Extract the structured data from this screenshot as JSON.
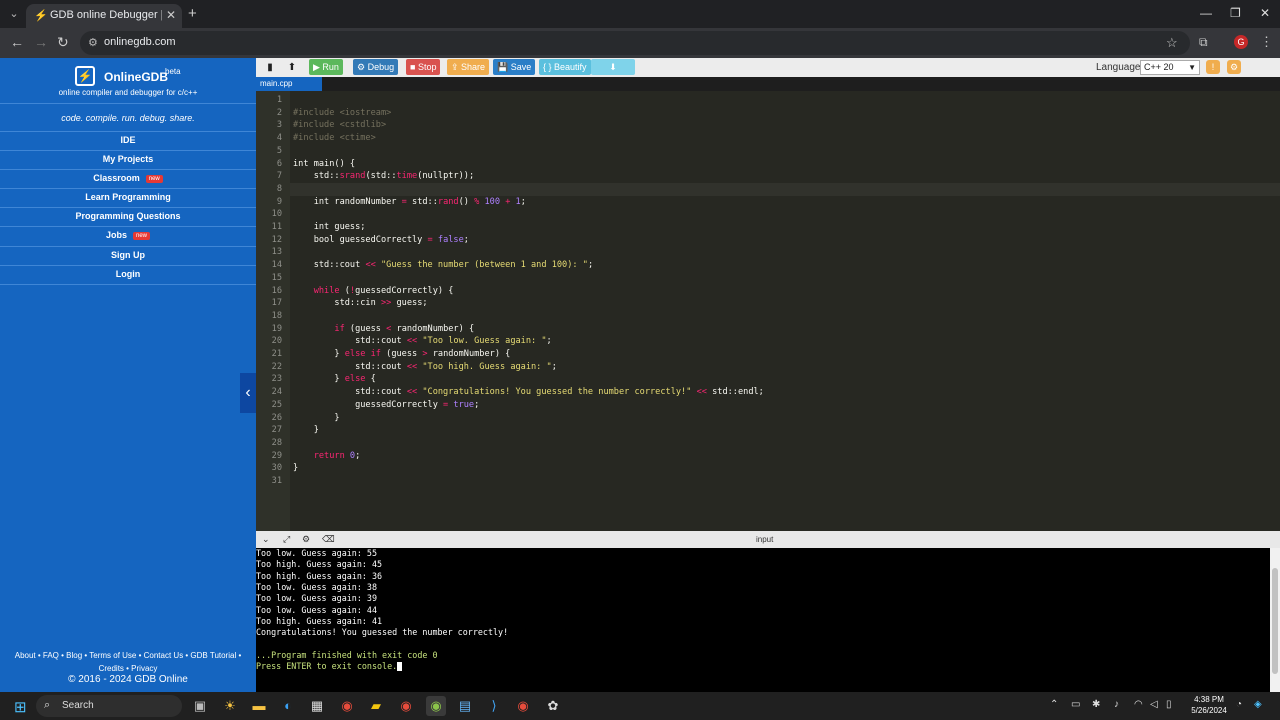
{
  "browser": {
    "tab_title": "GDB online Debugger | Compil",
    "url": "onlinegdb.com"
  },
  "sidebar": {
    "brand": "OnlineGDB",
    "beta": "beta",
    "tagline": "online compiler and debugger for c/c++",
    "motto": "code. compile. run. debug. share.",
    "nav": [
      {
        "label": "IDE",
        "badge": ""
      },
      {
        "label": "My Projects",
        "badge": ""
      },
      {
        "label": "Classroom",
        "badge": "new"
      },
      {
        "label": "Learn Programming",
        "badge": ""
      },
      {
        "label": "Programming Questions",
        "badge": ""
      },
      {
        "label": "Jobs",
        "badge": "new"
      },
      {
        "label": "Sign Up",
        "badge": ""
      },
      {
        "label": "Login",
        "badge": ""
      }
    ],
    "footer_line1": "About • FAQ • Blog • Terms of Use • Contact Us • GDB Tutorial •",
    "footer_line2": "Credits • Privacy",
    "copyright": "© 2016 - 2024 GDB Online"
  },
  "toolbar": {
    "run": "Run",
    "debug": "Debug",
    "stop": "Stop",
    "share": "Share",
    "save": "Save",
    "beautify": "{ } Beautify",
    "language_label": "Language",
    "language_value": "C++ 20"
  },
  "editor": {
    "file_tab": "main.cpp",
    "active_line": 8,
    "lines": [
      [],
      [
        {
          "t": "#include <iostream>",
          "c": "#75715e"
        }
      ],
      [
        {
          "t": "#include <cstdlib>",
          "c": "#75715e"
        }
      ],
      [
        {
          "t": "#include <ctime>",
          "c": "#75715e"
        }
      ],
      [],
      [
        {
          "t": "int main() {",
          "c": "#f8f8f2"
        }
      ],
      [
        {
          "t": "    std::",
          "c": "#f8f8f2"
        },
        {
          "t": "srand",
          "c": "#f92672"
        },
        {
          "t": "(std::",
          "c": "#f8f8f2"
        },
        {
          "t": "time",
          "c": "#f92672"
        },
        {
          "t": "(nullptr));",
          "c": "#f8f8f2"
        }
      ],
      [],
      [
        {
          "t": "    int randomNumber ",
          "c": "#f8f8f2"
        },
        {
          "t": "=",
          "c": "#f92672"
        },
        {
          "t": " std::",
          "c": "#f8f8f2"
        },
        {
          "t": "rand",
          "c": "#f92672"
        },
        {
          "t": "() ",
          "c": "#f8f8f2"
        },
        {
          "t": "%",
          "c": "#f92672"
        },
        {
          "t": " 100 ",
          "c": "#ae81ff"
        },
        {
          "t": "+",
          "c": "#f92672"
        },
        {
          "t": " 1",
          "c": "#ae81ff"
        },
        {
          "t": ";",
          "c": "#f8f8f2"
        }
      ],
      [],
      [
        {
          "t": "    int guess;",
          "c": "#f8f8f2"
        }
      ],
      [
        {
          "t": "    bool guessedCorrectly ",
          "c": "#f8f8f2"
        },
        {
          "t": "=",
          "c": "#f92672"
        },
        {
          "t": " false",
          "c": "#ae81ff"
        },
        {
          "t": ";",
          "c": "#f8f8f2"
        }
      ],
      [],
      [
        {
          "t": "    std::cout ",
          "c": "#f8f8f2"
        },
        {
          "t": "<<",
          "c": "#f92672"
        },
        {
          "t": " \"Guess the number (between 1 and 100): \"",
          "c": "#e6db74"
        },
        {
          "t": ";",
          "c": "#f8f8f2"
        }
      ],
      [],
      [
        {
          "t": "    while",
          "c": "#f92672"
        },
        {
          "t": " (",
          "c": "#f8f8f2"
        },
        {
          "t": "!",
          "c": "#f92672"
        },
        {
          "t": "guessedCorrectly) {",
          "c": "#f8f8f2"
        }
      ],
      [
        {
          "t": "        std::cin ",
          "c": "#f8f8f2"
        },
        {
          "t": ">>",
          "c": "#f92672"
        },
        {
          "t": " guess;",
          "c": "#f8f8f2"
        }
      ],
      [],
      [
        {
          "t": "        if",
          "c": "#f92672"
        },
        {
          "t": " (guess ",
          "c": "#f8f8f2"
        },
        {
          "t": "<",
          "c": "#f92672"
        },
        {
          "t": " randomNumber) {",
          "c": "#f8f8f2"
        }
      ],
      [
        {
          "t": "            std::cout ",
          "c": "#f8f8f2"
        },
        {
          "t": "<<",
          "c": "#f92672"
        },
        {
          "t": " \"Too low. Guess again: \"",
          "c": "#e6db74"
        },
        {
          "t": ";",
          "c": "#f8f8f2"
        }
      ],
      [
        {
          "t": "        } ",
          "c": "#f8f8f2"
        },
        {
          "t": "else if",
          "c": "#f92672"
        },
        {
          "t": " (guess ",
          "c": "#f8f8f2"
        },
        {
          "t": ">",
          "c": "#f92672"
        },
        {
          "t": " randomNumber) {",
          "c": "#f8f8f2"
        }
      ],
      [
        {
          "t": "            std::cout ",
          "c": "#f8f8f2"
        },
        {
          "t": "<<",
          "c": "#f92672"
        },
        {
          "t": " \"Too high. Guess again: \"",
          "c": "#e6db74"
        },
        {
          "t": ";",
          "c": "#f8f8f2"
        }
      ],
      [
        {
          "t": "        } ",
          "c": "#f8f8f2"
        },
        {
          "t": "else",
          "c": "#f92672"
        },
        {
          "t": " {",
          "c": "#f8f8f2"
        }
      ],
      [
        {
          "t": "            std::cout ",
          "c": "#f8f8f2"
        },
        {
          "t": "<<",
          "c": "#f92672"
        },
        {
          "t": " \"Congratulations! You guessed the number correctly!\" ",
          "c": "#e6db74"
        },
        {
          "t": "<<",
          "c": "#f92672"
        },
        {
          "t": " std::endl;",
          "c": "#f8f8f2"
        }
      ],
      [
        {
          "t": "            guessedCorrectly ",
          "c": "#f8f8f2"
        },
        {
          "t": "=",
          "c": "#f92672"
        },
        {
          "t": " true",
          "c": "#ae81ff"
        },
        {
          "t": ";",
          "c": "#f8f8f2"
        }
      ],
      [
        {
          "t": "        }",
          "c": "#f8f8f2"
        }
      ],
      [
        {
          "t": "    }",
          "c": "#f8f8f2"
        }
      ],
      [],
      [
        {
          "t": "    return",
          "c": "#f92672"
        },
        {
          "t": " 0",
          "c": "#ae81ff"
        },
        {
          "t": ";",
          "c": "#f8f8f2"
        }
      ],
      [
        {
          "t": "}",
          "c": "#f8f8f2"
        }
      ],
      []
    ]
  },
  "console": {
    "header_label": "input",
    "lines": [
      {
        "text": "Too low. Guess again: 55",
        "green": false
      },
      {
        "text": "Too high. Guess again: 45",
        "green": false
      },
      {
        "text": "Too high. Guess again: 36",
        "green": false
      },
      {
        "text": "Too low. Guess again: 38",
        "green": false
      },
      {
        "text": "Too low. Guess again: 39",
        "green": false
      },
      {
        "text": "Too low. Guess again: 44",
        "green": false
      },
      {
        "text": "Too high. Guess again: 41",
        "green": false
      },
      {
        "text": "Congratulations! You guessed the number correctly!",
        "green": false
      },
      {
        "text": "",
        "green": false
      },
      {
        "text": "...Program finished with exit code 0",
        "green": true
      },
      {
        "text": "Press ENTER to exit console.",
        "green": true
      }
    ]
  },
  "taskbar": {
    "search": "Search",
    "time": "4:38 PM",
    "date": "5/26/2024"
  },
  "colors": {
    "sidebar_blue": "#1565c0",
    "editor_bg": "#272822",
    "run_green": "#5cb85c",
    "debug_blue": "#337ab7",
    "stop_red": "#d9534f",
    "share_orange": "#f0ad4e",
    "save_blue": "#2a7ec7",
    "beautify_cyan": "#5bc0de",
    "download_cyan": "#7fd3ea"
  }
}
